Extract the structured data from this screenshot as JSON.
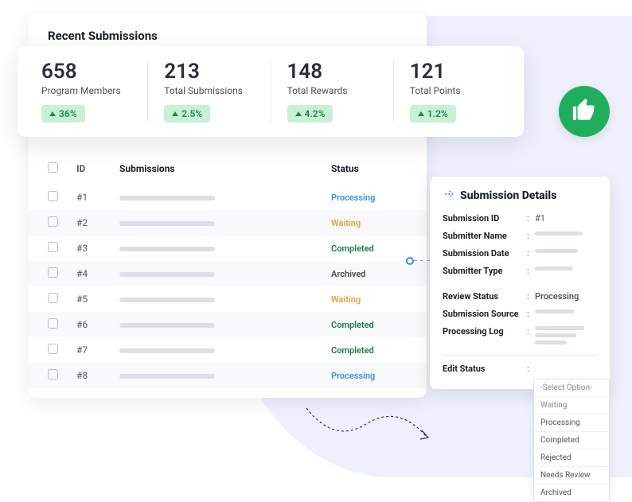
{
  "title": "Recent Submissions",
  "stats": [
    {
      "value": "658",
      "label": "Program Members",
      "change": "36%"
    },
    {
      "value": "213",
      "label": "Total Submissions",
      "change": "2.5%"
    },
    {
      "value": "148",
      "label": "Total Rewards",
      "change": "4.2%"
    },
    {
      "value": "121",
      "label": "Total Points",
      "change": "1.2%"
    }
  ],
  "table": {
    "headers": {
      "id": "ID",
      "submissions": "Submissions",
      "status": "Status"
    },
    "rows": [
      {
        "id": "#1",
        "status": "Processing",
        "statusClass": "status-processing"
      },
      {
        "id": "#2",
        "status": "Waiting",
        "statusClass": "status-waiting"
      },
      {
        "id": "#3",
        "status": "Completed",
        "statusClass": "status-completed"
      },
      {
        "id": "#4",
        "status": "Archived",
        "statusClass": "status-archived"
      },
      {
        "id": "#5",
        "status": "Waiting",
        "statusClass": "status-waiting"
      },
      {
        "id": "#6",
        "status": "Completed",
        "statusClass": "status-completed"
      },
      {
        "id": "#7",
        "status": "Completed",
        "statusClass": "status-completed"
      },
      {
        "id": "#8",
        "status": "Processing",
        "statusClass": "status-processing"
      }
    ]
  },
  "details": {
    "title": "Submission Details",
    "fields": {
      "submission_id": {
        "label": "Submission ID",
        "value": "#1"
      },
      "submitter_name": {
        "label": "Submitter Name"
      },
      "submission_date": {
        "label": "Submission Date"
      },
      "submitter_type": {
        "label": "Submitter Type"
      },
      "review_status": {
        "label": "Review Status",
        "value": "Processing"
      },
      "submission_source": {
        "label": "Submission Source"
      },
      "processing_log": {
        "label": "Processing Log"
      },
      "edit_status": {
        "label": "Edit Status"
      }
    }
  },
  "dropdown": {
    "placeholder": "-Select Option-",
    "options": [
      "Waiting",
      "Processing",
      "Completed",
      "Rejected",
      "Needs Review",
      "Archived"
    ]
  }
}
